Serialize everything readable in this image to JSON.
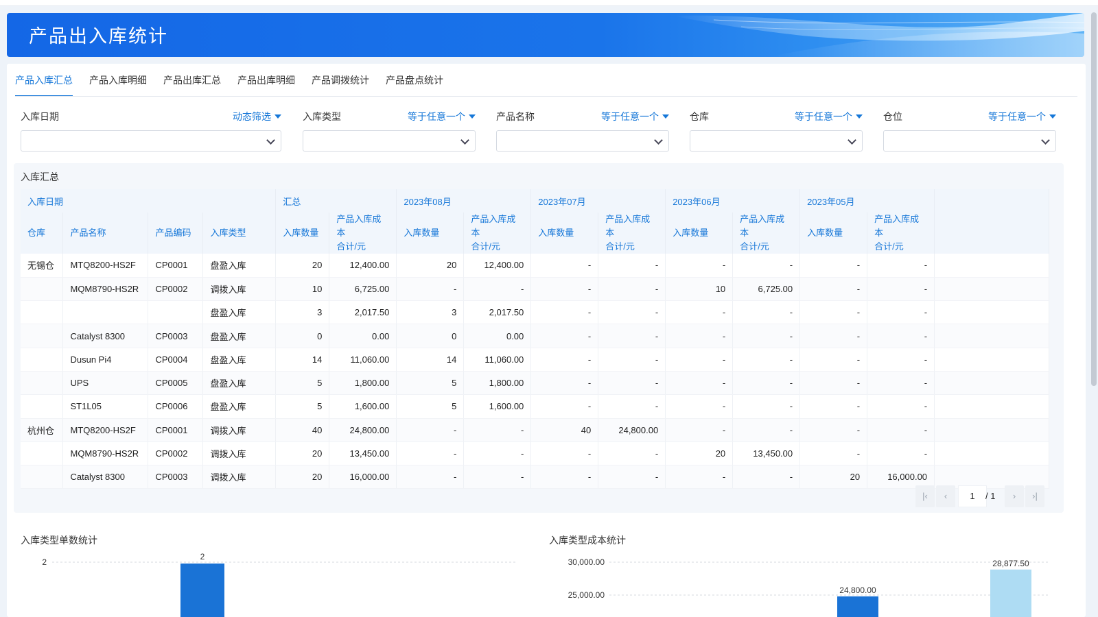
{
  "header": {
    "title": "产品出入库统计"
  },
  "tabs": [
    {
      "label": "产品入库汇总",
      "active": true
    },
    {
      "label": "产品入库明细",
      "active": false
    },
    {
      "label": "产品出库汇总",
      "active": false
    },
    {
      "label": "产品出库明细",
      "active": false
    },
    {
      "label": "产品调拨统计",
      "active": false
    },
    {
      "label": "产品盘点统计",
      "active": false
    }
  ],
  "filters": [
    {
      "label": "入库日期",
      "mode": "动态筛选",
      "value": ""
    },
    {
      "label": "入库类型",
      "mode": "等于任意一个",
      "value": ""
    },
    {
      "label": "产品名称",
      "mode": "等于任意一个",
      "value": ""
    },
    {
      "label": "仓库",
      "mode": "等于任意一个",
      "value": ""
    },
    {
      "label": "仓位",
      "mode": "等于任意一个",
      "value": ""
    }
  ],
  "summary": {
    "title": "入库汇总",
    "group_header": [
      "入库日期",
      "汇总",
      "2023年08月",
      "2023年07月",
      "2023年06月",
      "2023年05月"
    ],
    "columns": [
      "仓库",
      "产品名称",
      "产品编码",
      "入库类型",
      "入库数量",
      "产品入库成本合计/元",
      "入库数量",
      "产品入库成本合计/元",
      "入库数量",
      "产品入库成本合计/元",
      "入库数量",
      "产品入库成本合计/元",
      "入库数量",
      "产品入库成本合计/元"
    ],
    "cost_header_lines": [
      "产品入库成本",
      "合计/元"
    ],
    "rows": [
      [
        "无锡仓",
        "MTQ8200-HS2F",
        "CP0001",
        "盘盈入库",
        "20",
        "12,400.00",
        "20",
        "12,400.00",
        "-",
        "-",
        "-",
        "-",
        "-",
        "-"
      ],
      [
        "",
        "MQM8790-HS2R",
        "CP0002",
        "调拨入库",
        "10",
        "6,725.00",
        "-",
        "-",
        "-",
        "-",
        "10",
        "6,725.00",
        "-",
        "-"
      ],
      [
        "",
        "",
        "",
        "盘盈入库",
        "3",
        "2,017.50",
        "3",
        "2,017.50",
        "-",
        "-",
        "-",
        "-",
        "-",
        "-"
      ],
      [
        "",
        "Catalyst 8300",
        "CP0003",
        "盘盈入库",
        "0",
        "0.00",
        "0",
        "0.00",
        "-",
        "-",
        "-",
        "-",
        "-",
        "-"
      ],
      [
        "",
        "Dusun Pi4",
        "CP0004",
        "盘盈入库",
        "14",
        "11,060.00",
        "14",
        "11,060.00",
        "-",
        "-",
        "-",
        "-",
        "-",
        "-"
      ],
      [
        "",
        "UPS",
        "CP0005",
        "盘盈入库",
        "5",
        "1,800.00",
        "5",
        "1,800.00",
        "-",
        "-",
        "-",
        "-",
        "-",
        "-"
      ],
      [
        "",
        "ST1L05",
        "CP0006",
        "盘盈入库",
        "5",
        "1,600.00",
        "5",
        "1,600.00",
        "-",
        "-",
        "-",
        "-",
        "-",
        "-"
      ],
      [
        "杭州仓",
        "MTQ8200-HS2F",
        "CP0001",
        "调拨入库",
        "40",
        "24,800.00",
        "-",
        "-",
        "40",
        "24,800.00",
        "-",
        "-",
        "-",
        "-"
      ],
      [
        "",
        "MQM8790-HS2R",
        "CP0002",
        "调拨入库",
        "20",
        "13,450.00",
        "-",
        "-",
        "-",
        "-",
        "20",
        "13,450.00",
        "-",
        "-"
      ],
      [
        "",
        "Catalyst 8300",
        "CP0003",
        "调拨入库",
        "20",
        "16,000.00",
        "-",
        "-",
        "-",
        "-",
        "-",
        "-",
        "20",
        "16,000.00"
      ]
    ]
  },
  "pagination": {
    "current": "1",
    "total": "/ 1"
  },
  "charts": {
    "left_title": "入库类型单数统计",
    "right_title": "入库类型成本统计"
  },
  "chart_data": [
    {
      "type": "bar",
      "title": "入库类型单数统计",
      "yticks": [
        "2"
      ],
      "series": [
        {
          "values": [
            2
          ]
        }
      ],
      "data_labels": [
        "2"
      ],
      "colors": [
        "#1a73d6"
      ]
    },
    {
      "type": "bar",
      "title": "入库类型成本统计",
      "yticks": [
        "30,000.00",
        "25,000.00"
      ],
      "series": [
        {
          "values": [
            24800,
            28877.5
          ]
        }
      ],
      "data_labels": [
        "24,800.00",
        "28,877.50"
      ],
      "colors": [
        "#1a73d6",
        "#aedcf3"
      ]
    }
  ]
}
